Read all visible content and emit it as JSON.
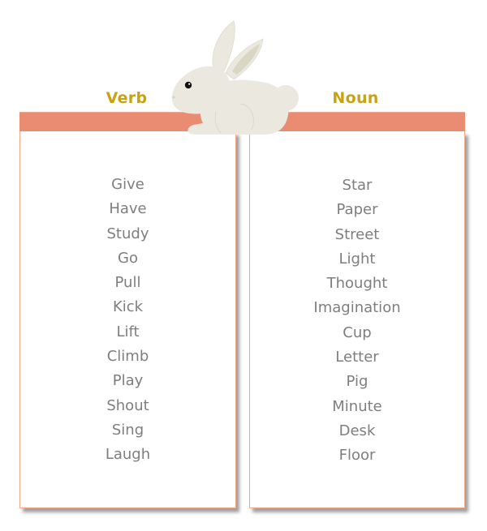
{
  "columns": [
    {
      "title": "Verb",
      "items": [
        "Give",
        "Have",
        "Study",
        "Go",
        "Pull",
        "Kick",
        "Lift",
        "Climb",
        "Play",
        "Shout",
        "Sing",
        "Laugh"
      ]
    },
    {
      "title": "Noun",
      "items": [
        "Star",
        "Paper",
        "Street",
        "Light",
        "Thought",
        "Imagination",
        "Cup",
        "Letter",
        "Pig",
        "Minute",
        "Desk",
        "Floor"
      ]
    }
  ],
  "decoration": {
    "illustration": "rabbit-illustration"
  },
  "colors": {
    "header_band": "#e98c72",
    "card_border": "#f4a889",
    "title_text": "#c7a314",
    "item_text": "#7e7e7e",
    "rabbit_body": "#ebe9df",
    "rabbit_ear_inner": "#d9d7c3"
  }
}
